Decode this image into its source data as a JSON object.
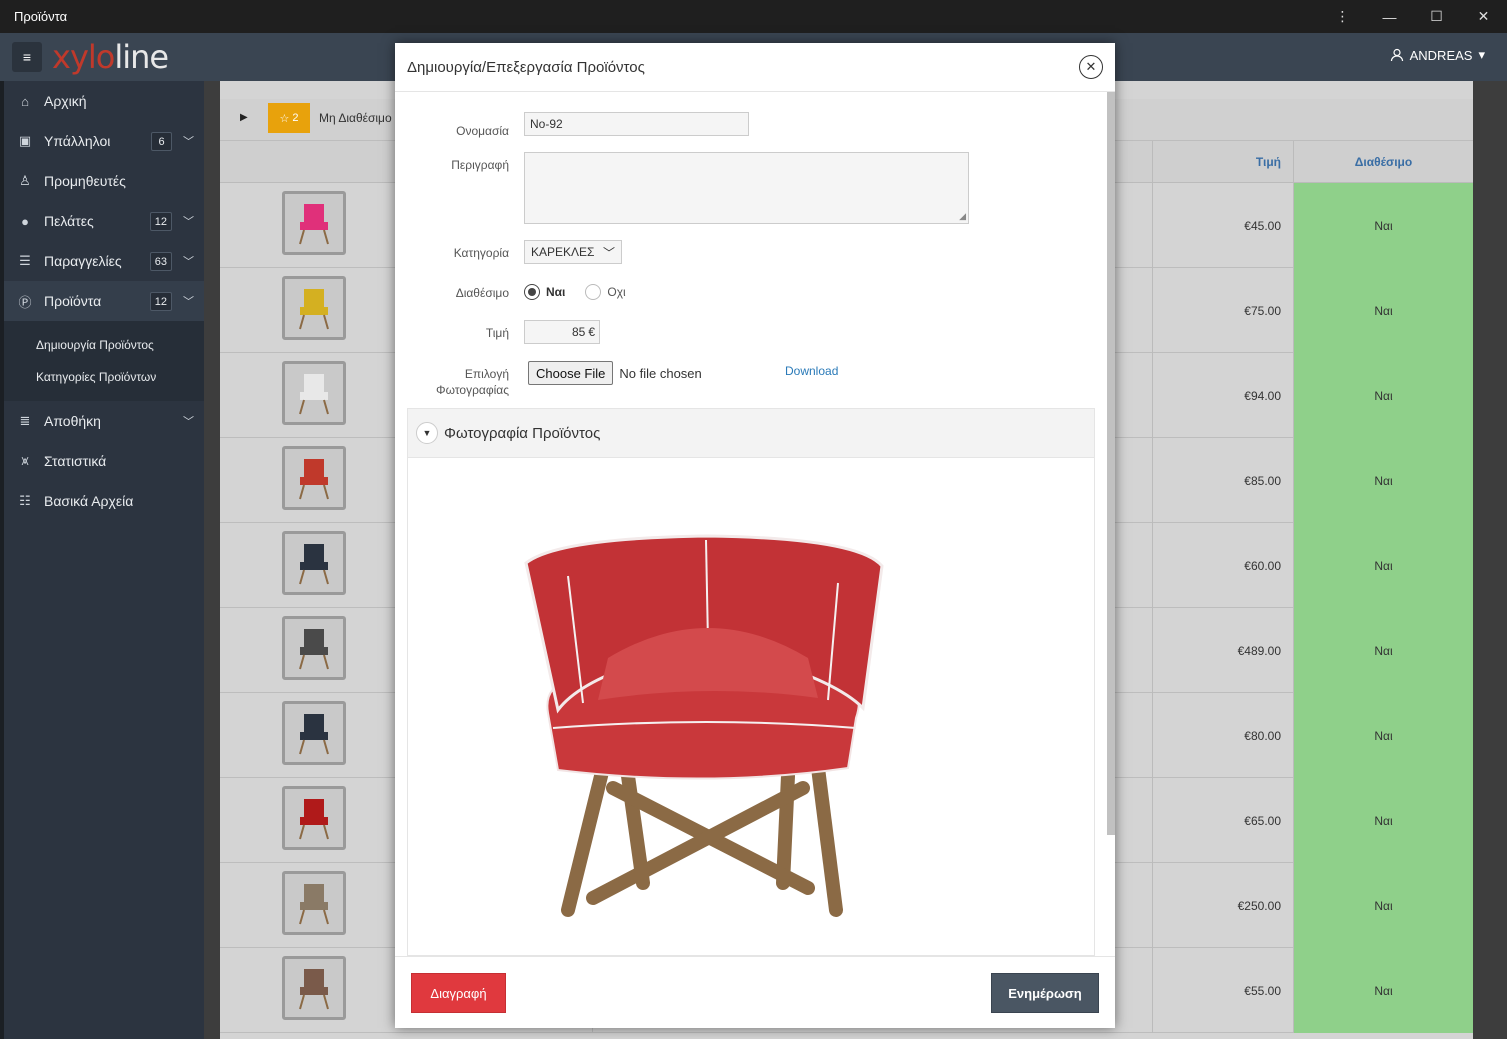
{
  "window": {
    "title": "Προϊόντα"
  },
  "header": {
    "logo_xy": "xylo",
    "logo_rest": "line",
    "user": "ANDREAS"
  },
  "sidebar": {
    "items": [
      {
        "label": "Αρχική",
        "icon": "home-icon"
      },
      {
        "label": "Υπάλληλοι",
        "badge": "6",
        "icon": "id-card-icon"
      },
      {
        "label": "Προμηθευτές",
        "icon": "user-icon"
      },
      {
        "label": "Πελάτες",
        "badge": "12",
        "icon": "user-circle-icon"
      },
      {
        "label": "Παραγγελίες",
        "badge": "63",
        "icon": "list-icon"
      },
      {
        "label": "Προϊόντα",
        "badge": "12",
        "icon": "product-icon"
      },
      {
        "label": "Αποθήκη",
        "icon": "database-icon"
      },
      {
        "label": "Στατιστικά",
        "icon": "chart-icon"
      },
      {
        "label": "Βασικά Αρχεία",
        "icon": "files-icon"
      }
    ],
    "subitems": [
      {
        "label": "Δημιουργία Προϊόντος"
      },
      {
        "label": "Κατηγορίες Προϊόντων"
      }
    ]
  },
  "table": {
    "group": {
      "count": "2",
      "label": "Μη Διαθέσιμο"
    },
    "headers": {
      "price": "Τιμή",
      "available": "Διαθέσιμο"
    },
    "rows": [
      {
        "price": "€45.00",
        "available": "Ναι",
        "thumb_color": "#e0307a"
      },
      {
        "price": "€75.00",
        "available": "Ναι",
        "thumb_color": "#d4b021"
      },
      {
        "price": "€94.00",
        "available": "Ναι",
        "thumb_color": "#e8e8e8"
      },
      {
        "price": "€85.00",
        "available": "Ναι",
        "thumb_color": "#c0392b"
      },
      {
        "price": "€60.00",
        "available": "Ναι",
        "thumb_color": "#2a3340"
      },
      {
        "price": "€489.00",
        "available": "Ναι",
        "thumb_color": "#4a4a4a"
      },
      {
        "price": "€80.00",
        "available": "Ναι",
        "thumb_color": "#2a3340"
      },
      {
        "price": "€65.00",
        "available": "Ναι",
        "thumb_color": "#b01a1a"
      },
      {
        "price": "€250.00",
        "available": "Ναι",
        "thumb_color": "#8a7a66"
      },
      {
        "price": "€55.00",
        "available": "Ναι",
        "thumb_color": "#7a5a4a"
      }
    ]
  },
  "modal": {
    "title": "Δημιουργία/Επεξεργασία Προϊόντος",
    "fields": {
      "name_label": "Ονομασία",
      "name_value": "No-92",
      "desc_label": "Περιγραφή",
      "desc_value": "",
      "category_label": "Κατηγορία",
      "category_value": "ΚΑΡΕΚΛΕΣ",
      "available_label": "Διαθέσιμο",
      "yes_label": "Ναι",
      "no_label": "Οχι",
      "price_label": "Τιμή",
      "price_value": "85",
      "currency": "€",
      "photo_label_1": "Επιλογή",
      "photo_label_2": "Φωτογραφίας",
      "file_button": "Choose File",
      "file_status": "No file chosen",
      "download_link": "Download"
    },
    "panel_title": "Φωτογραφία Προϊόντος",
    "delete_button": "Διαγραφή",
    "update_button": "Ενημέρωση"
  },
  "colors": {
    "accent_red": "#e0393e",
    "available_green": "#8fd08a",
    "header_dark": "#3a4552",
    "badge_orange": "#e8a20c"
  }
}
